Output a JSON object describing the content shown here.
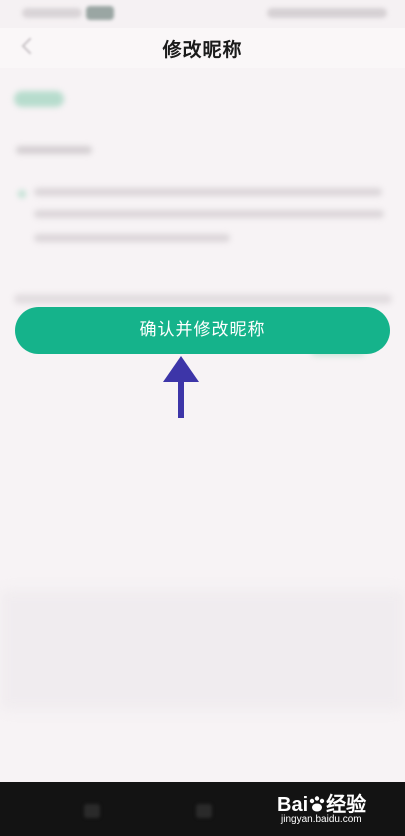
{
  "header": {
    "title": "修改昵称"
  },
  "actions": {
    "confirm_label": "确认并修改昵称"
  },
  "colors": {
    "accent": "#15b38b",
    "arrow": "#3d35a8"
  },
  "watermark": {
    "brand_left": "Bai",
    "brand_right": "经验",
    "domain": "jingyan.baidu.com"
  }
}
